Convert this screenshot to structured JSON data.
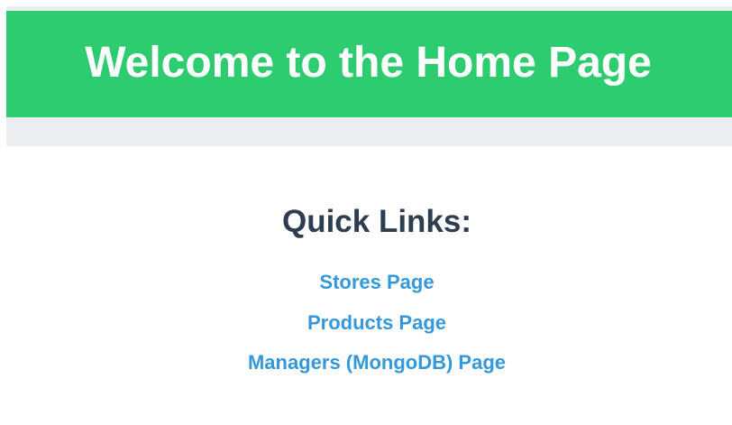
{
  "header": {
    "title": "Welcome to the Home Page"
  },
  "quick_links": {
    "heading": "Quick Links:",
    "items": [
      {
        "label": "Stores Page"
      },
      {
        "label": "Products Page"
      },
      {
        "label": "Managers (MongoDB) Page"
      }
    ]
  },
  "colors": {
    "header_bg": "#2ecc71",
    "header_text": "#ffffff",
    "heading_text": "#2c3e50",
    "link": "#3498db"
  }
}
